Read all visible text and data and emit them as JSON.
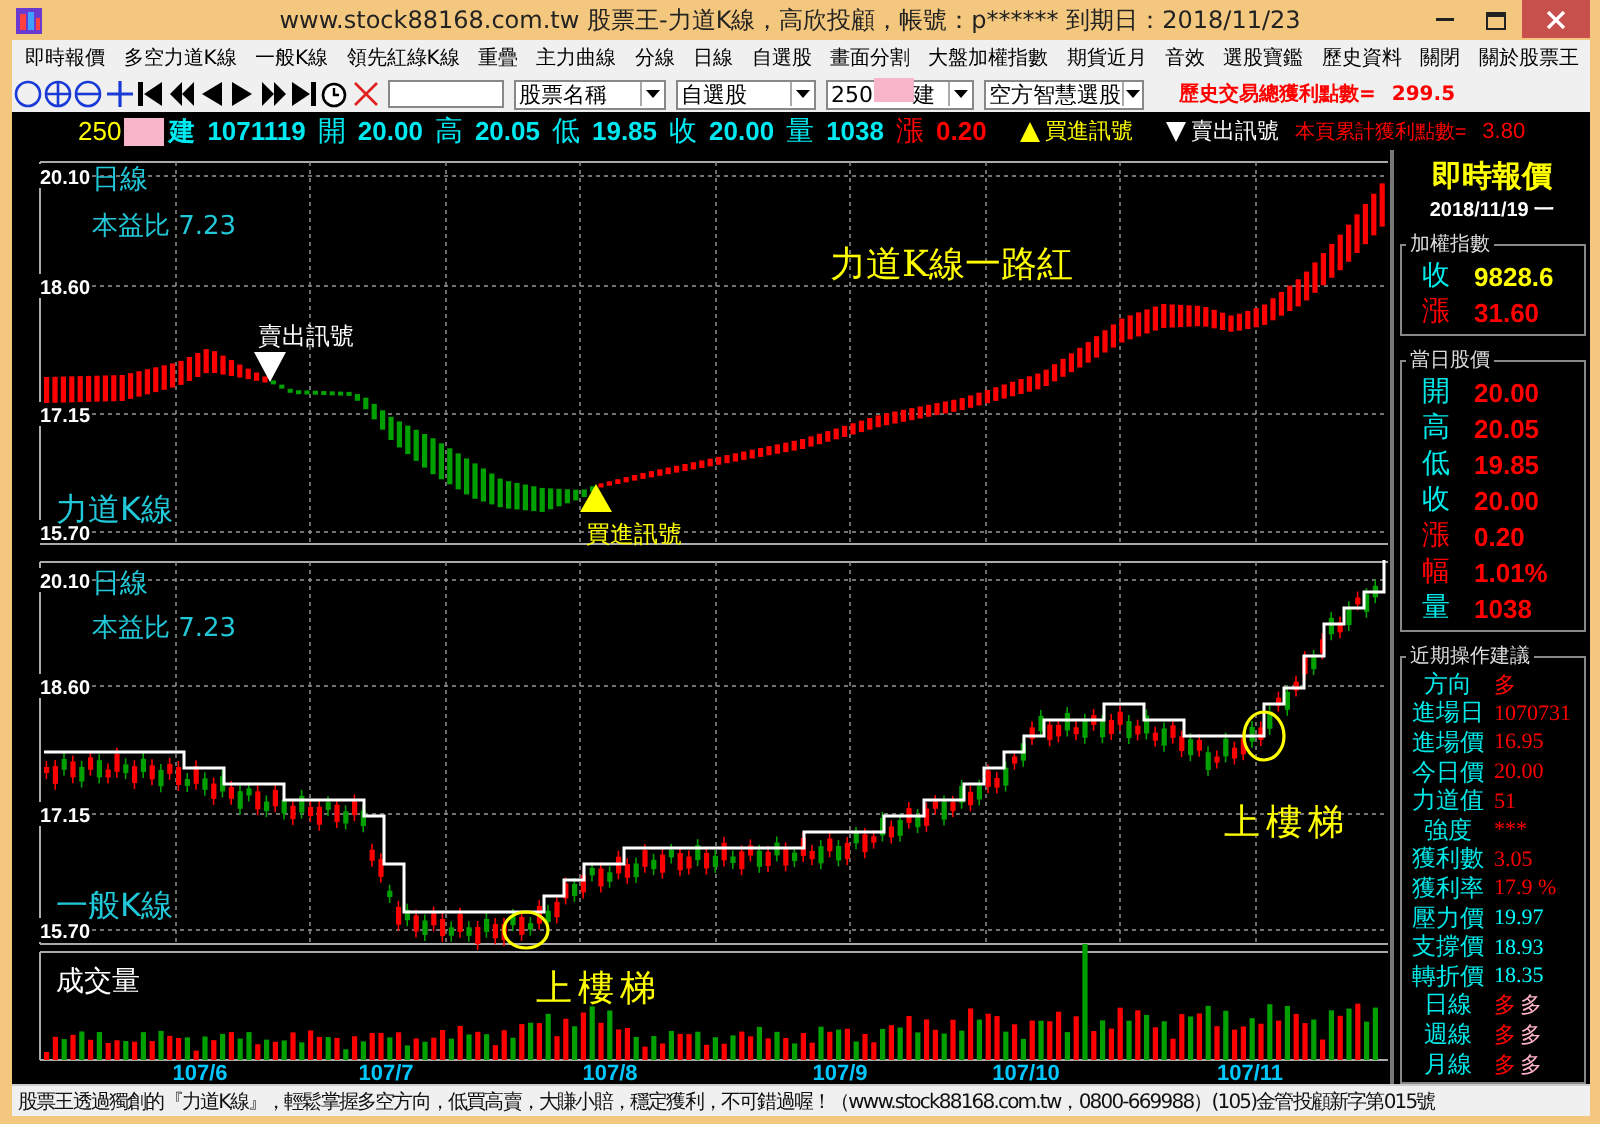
{
  "window": {
    "title": "www.stock88168.com.tw 股票王-力道K線，高欣投顧，帳號：p****** 到期日：2018/11/23"
  },
  "menu": [
    "即時報價",
    "多空力道K線",
    "一般K線",
    "領先紅綠K線",
    "重疊",
    "主力曲線",
    "分線",
    "日線",
    "自選股",
    "畫面分割",
    "大盤加權指數",
    "期貨近月",
    "音效",
    "選股寶鑑",
    "歷史資料",
    "關閉",
    "關於股票王"
  ],
  "toolbar": {
    "selects": [
      {
        "kind": "text",
        "value": "股票名稱"
      },
      {
        "kind": "text",
        "value": "自選股"
      },
      {
        "kind": "stock",
        "code": "250",
        "name_tail": "建"
      },
      {
        "kind": "text",
        "value": "空方智慧選股"
      }
    ],
    "total_profit": {
      "label": "歷史交易總獲利點數=",
      "value": "299.5"
    }
  },
  "quote_bar": {
    "code": "250",
    "name_tail": "建",
    "date": "1071119",
    "fields": [
      {
        "label": "開",
        "value": "20.00"
      },
      {
        "label": "高",
        "value": "20.05"
      },
      {
        "label": "低",
        "value": "19.85"
      },
      {
        "label": "收",
        "value": "20.00"
      },
      {
        "label": "量",
        "value": "1038"
      }
    ],
    "change": {
      "label": "漲",
      "value": "0.20"
    },
    "legend": [
      {
        "kind": "buy",
        "label": "買進訊號"
      },
      {
        "kind": "sell",
        "label": "賣出訊號"
      }
    ],
    "page_profit": {
      "label": "本頁累計獲利點數=",
      "value": "3.80"
    }
  },
  "charts": {
    "power": {
      "y_ticks": [
        "20.10",
        "18.60",
        "17.15",
        "15.70"
      ],
      "period": "日線",
      "pe": "本益比 7.23",
      "name": "力道K線",
      "headline": "力道K線一路紅",
      "signals": [
        {
          "kind": "sell",
          "label": "賣出訊號"
        },
        {
          "kind": "buy",
          "label": "買進訊號"
        }
      ]
    },
    "candles": {
      "y_ticks": [
        "20.10",
        "18.60",
        "17.15",
        "15.70"
      ],
      "period": "日線",
      "pe": "本益比 7.23",
      "name": "一般K線",
      "notes": [
        "上樓梯",
        "上樓梯"
      ]
    },
    "volume": {
      "name": "成交量"
    },
    "x_labels": [
      "107/6",
      "107/7",
      "107/8",
      "107/9",
      "107/10",
      "107/11"
    ]
  },
  "panel": {
    "title": "即時報價",
    "date": "2018/11/19 一",
    "groups": [
      {
        "title": "加權指數",
        "kind": "quote",
        "rows": [
          {
            "label": "收",
            "kind": "price",
            "values": [
              {
                "text": "9828.6",
                "color": "#ffff00"
              }
            ]
          },
          {
            "label": "漲",
            "kind": "change",
            "values": [
              {
                "text": "31.60",
                "color": "#ff0000"
              }
            ]
          }
        ]
      },
      {
        "title": "當日股價",
        "kind": "quote",
        "rows": [
          {
            "label": "開",
            "kind": "price",
            "values": [
              {
                "text": "20.00",
                "color": "#ff0000"
              }
            ]
          },
          {
            "label": "高",
            "kind": "price",
            "values": [
              {
                "text": "20.05",
                "color": "#ff0000"
              }
            ]
          },
          {
            "label": "低",
            "kind": "price",
            "values": [
              {
                "text": "19.85",
                "color": "#ff0000"
              }
            ]
          },
          {
            "label": "收",
            "kind": "price",
            "values": [
              {
                "text": "20.00",
                "color": "#ff0000"
              }
            ]
          },
          {
            "label": "漲",
            "kind": "change",
            "values": [
              {
                "text": "0.20",
                "color": "#ff0000"
              }
            ]
          },
          {
            "label": "幅",
            "kind": "change",
            "values": [
              {
                "text": "1.01%",
                "color": "#ff0000"
              }
            ]
          },
          {
            "label": "量",
            "kind": "price",
            "values": [
              {
                "text": "1038",
                "color": "#ff0000"
              }
            ]
          }
        ]
      },
      {
        "title": "近期操作建議",
        "kind": "advice",
        "rows": [
          {
            "label": "方向",
            "kind": "price",
            "values": [
              {
                "text": "多",
                "color": "#ff0000"
              }
            ]
          },
          {
            "label": "進場日",
            "kind": "price",
            "values": [
              {
                "text": "1070731",
                "color": "#ff0000"
              }
            ]
          },
          {
            "label": "進場價",
            "kind": "price",
            "values": [
              {
                "text": "16.95",
                "color": "#ff0000"
              }
            ]
          },
          {
            "label": "今日價",
            "kind": "price",
            "values": [
              {
                "text": "20.00",
                "color": "#ff0000"
              }
            ]
          },
          {
            "label": "力道值",
            "kind": "price",
            "values": [
              {
                "text": "51",
                "color": "#ff0000"
              }
            ]
          },
          {
            "label": "強度",
            "kind": "price",
            "values": [
              {
                "text": "***",
                "color": "#ff0000"
              }
            ]
          },
          {
            "label": "獲利數",
            "kind": "price",
            "values": [
              {
                "text": "3.05",
                "color": "#ff0000"
              }
            ]
          },
          {
            "label": "獲利率",
            "kind": "price",
            "values": [
              {
                "text": "17.9 %",
                "color": "#ff0000"
              }
            ]
          },
          {
            "label": "壓力價",
            "kind": "price",
            "values": [
              {
                "text": "19.97",
                "color": "#00ffff"
              }
            ]
          },
          {
            "label": "支撐價",
            "kind": "price",
            "values": [
              {
                "text": "18.93",
                "color": "#00ffff"
              }
            ]
          },
          {
            "label": "轉折價",
            "kind": "price",
            "values": [
              {
                "text": "18.35",
                "color": "#00ffff"
              }
            ]
          },
          {
            "label": "日線",
            "kind": "price",
            "values": [
              {
                "text": "多",
                "color": "#ff0000"
              },
              {
                "text": "多",
                "color": "#ffb4c8"
              }
            ]
          },
          {
            "label": "週線",
            "kind": "price",
            "values": [
              {
                "text": "多",
                "color": "#ff0000"
              },
              {
                "text": "多",
                "color": "#ffb4c8"
              }
            ]
          },
          {
            "label": "月線",
            "kind": "price",
            "values": [
              {
                "text": "多",
                "color": "#ff0000"
              },
              {
                "text": "多",
                "color": "#ffb4c8"
              }
            ]
          }
        ]
      }
    ]
  },
  "status_bar": {
    "text": "股票王透過獨創的『力道K線』，輕鬆掌握多空方向，低買高賣，大賺小賠，穩定獲利，不可錯過喔！（www.stock88168.com.tw，0800-669988）(105)金管投顧新字第015號"
  }
}
